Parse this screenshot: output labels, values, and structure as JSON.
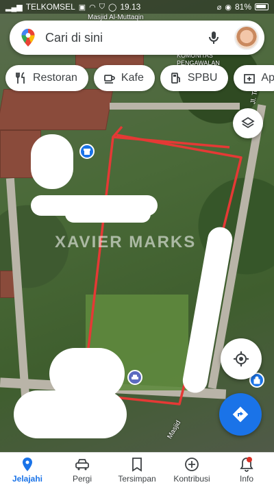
{
  "status_bar": {
    "carrier": "TELKOMSEL",
    "time": "19.13",
    "battery": "81%"
  },
  "search": {
    "placeholder": "Cari di sini"
  },
  "chips": [
    {
      "label": "Restoran",
      "icon": "restaurant-icon"
    },
    {
      "label": "Kafe",
      "icon": "cafe-icon"
    },
    {
      "label": "SPBU",
      "icon": "gas-station-icon"
    },
    {
      "label": "Ap",
      "icon": "apotek-icon"
    }
  ],
  "map": {
    "labels": {
      "mosque": "Masjid Al-Muttaqin",
      "komunitas": "KOMUNITAS PENGAWALAN",
      "street_bottom": "Masjid",
      "street_right": "Jl. To"
    },
    "watermark": "XAVIER MARKS",
    "boundary_color": "#e53935"
  },
  "bottom_nav": [
    {
      "label": "Jelajahi",
      "icon": "explore-pin-icon",
      "active": true
    },
    {
      "label": "Pergi",
      "icon": "car-icon",
      "active": false
    },
    {
      "label": "Tersimpan",
      "icon": "bookmark-icon",
      "active": false
    },
    {
      "label": "Kontribusi",
      "icon": "add-circle-icon",
      "active": false
    },
    {
      "label": "Info",
      "icon": "bell-icon",
      "active": false
    }
  ],
  "colors": {
    "accent": "#1a73e8",
    "notification": "#d93025"
  }
}
